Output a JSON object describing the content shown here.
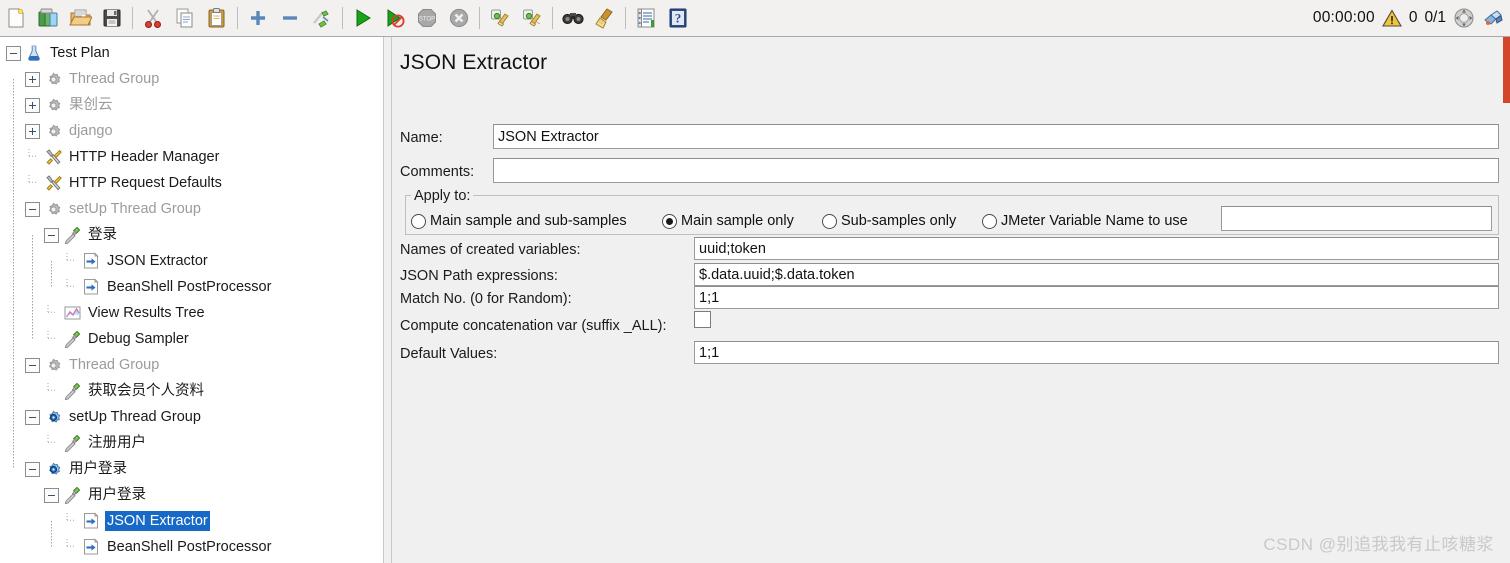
{
  "toolbar": {
    "buttons": [
      {
        "name": "new-icon",
        "title": "New"
      },
      {
        "name": "templates-icon",
        "title": "Templates"
      },
      {
        "name": "open-icon",
        "title": "Open"
      },
      {
        "name": "save-icon",
        "title": "Save Test Plan"
      },
      {
        "name": "cut-icon",
        "title": "Cut"
      },
      {
        "name": "copy-icon",
        "title": "Copy"
      },
      {
        "name": "paste-icon",
        "title": "Paste"
      },
      {
        "name": "expand-all-icon",
        "title": "Expand All"
      },
      {
        "name": "collapse-all-icon",
        "title": "Collapse All"
      },
      {
        "name": "toggle-icon",
        "title": "Toggle"
      },
      {
        "name": "start-icon",
        "title": "Start"
      },
      {
        "name": "start-no-pauses-icon",
        "title": "Start no pauses"
      },
      {
        "name": "stop-icon",
        "title": "Stop"
      },
      {
        "name": "shutdown-icon",
        "title": "Shutdown"
      },
      {
        "name": "clear-icon",
        "title": "Clear"
      },
      {
        "name": "clear-all-icon",
        "title": "Clear All"
      },
      {
        "name": "search-icon",
        "title": "Search"
      },
      {
        "name": "reset-search-icon",
        "title": "Reset Search"
      },
      {
        "name": "function-helper-icon",
        "title": "Function Helper Dialog"
      },
      {
        "name": "help-icon",
        "title": "Help"
      }
    ],
    "elapsed_time": "00:00:00",
    "warning_icon": "warning-triangle-icon",
    "error_count": "0",
    "threads_running": "0/1",
    "stop_all_icon": "stop-all-icon",
    "remote_icon": "remote-engine-icon"
  },
  "tree": {
    "nodes": [
      {
        "label": "Test Plan",
        "depth": 0,
        "icon": "test-plan-icon",
        "toggle": "minus",
        "dim": false,
        "selected": false
      },
      {
        "label": "Thread Group",
        "depth": 1,
        "icon": "thread-group-icon",
        "toggle": "plus",
        "dim": true,
        "selected": false
      },
      {
        "label": "果创云",
        "depth": 1,
        "icon": "thread-group-icon",
        "toggle": "plus",
        "dim": true,
        "selected": false
      },
      {
        "label": "django",
        "depth": 1,
        "icon": "thread-group-icon",
        "toggle": "plus",
        "dim": true,
        "selected": false
      },
      {
        "label": "HTTP Header Manager",
        "depth": 1,
        "icon": "config-element-icon",
        "toggle": "none",
        "dim": false,
        "selected": false
      },
      {
        "label": "HTTP Request Defaults",
        "depth": 1,
        "icon": "config-element-icon",
        "toggle": "none",
        "dim": false,
        "selected": false
      },
      {
        "label": "setUp Thread Group",
        "depth": 1,
        "icon": "thread-group-icon",
        "toggle": "minus",
        "dim": true,
        "selected": false
      },
      {
        "label": "登录",
        "depth": 2,
        "icon": "sampler-icon",
        "toggle": "minus",
        "dim": false,
        "selected": false
      },
      {
        "label": "JSON Extractor",
        "depth": 3,
        "icon": "post-processor-icon",
        "toggle": "none",
        "dim": false,
        "selected": false
      },
      {
        "label": "BeanShell PostProcessor",
        "depth": 3,
        "icon": "post-processor-icon",
        "toggle": "none",
        "dim": false,
        "selected": false
      },
      {
        "label": "View Results Tree",
        "depth": 2,
        "icon": "listener-icon",
        "toggle": "none",
        "dim": false,
        "selected": false
      },
      {
        "label": "Debug Sampler",
        "depth": 2,
        "icon": "sampler-icon",
        "toggle": "none",
        "dim": false,
        "selected": false
      },
      {
        "label": "Thread Group",
        "depth": 1,
        "icon": "thread-group-icon",
        "toggle": "minus",
        "dim": true,
        "selected": false
      },
      {
        "label": "获取会员个人资料",
        "depth": 2,
        "icon": "sampler-icon",
        "toggle": "none",
        "dim": false,
        "selected": false
      },
      {
        "label": "setUp Thread Group",
        "depth": 1,
        "icon": "setup-thread-group-icon",
        "toggle": "minus",
        "dim": false,
        "selected": false
      },
      {
        "label": "注册用户",
        "depth": 2,
        "icon": "sampler-icon",
        "toggle": "none",
        "dim": false,
        "selected": false
      },
      {
        "label": "用户登录",
        "depth": 1,
        "icon": "setup-thread-group-icon",
        "toggle": "minus",
        "dim": false,
        "selected": false
      },
      {
        "label": "用户登录",
        "depth": 2,
        "icon": "sampler-icon",
        "toggle": "minus",
        "dim": false,
        "selected": false
      },
      {
        "label": "JSON Extractor",
        "depth": 3,
        "icon": "post-processor-icon",
        "toggle": "none",
        "dim": false,
        "selected": true
      },
      {
        "label": "BeanShell PostProcessor",
        "depth": 3,
        "icon": "post-processor-icon",
        "toggle": "none",
        "dim": false,
        "selected": false
      }
    ]
  },
  "panel": {
    "title": "JSON Extractor",
    "name_label": "Name:",
    "name_value": "JSON Extractor",
    "comments_label": "Comments:",
    "comments_value": "",
    "apply_to_label": "Apply to:",
    "apply_to_options": [
      {
        "label": "Main sample and sub-samples",
        "selected": false
      },
      {
        "label": "Main sample only",
        "selected": true
      },
      {
        "label": "Sub-samples only",
        "selected": false
      },
      {
        "label": "JMeter Variable Name to use",
        "selected": false
      }
    ],
    "jmeter_variable_value": "",
    "fields": [
      {
        "label": "Names of created variables:",
        "value": "uuid;token"
      },
      {
        "label": "JSON Path expressions:",
        "value": "$.data.uuid;$.data.token"
      },
      {
        "label": "Match No. (0 for Random):",
        "value": "1;1"
      }
    ],
    "concat_label": "Compute concatenation var (suffix _ALL):",
    "concat_checked": false,
    "default_values_label": "Default Values:",
    "default_values_value": "1;1"
  },
  "watermark": "CSDN @别追我我有止咳糖浆",
  "colors": {
    "selection_blue": "#1669c7",
    "panel_bg": "#f0f0f0",
    "tree_bg": "#ffffff",
    "disabled_text": "#9b9b9b",
    "accent_red": "#d4462a"
  }
}
